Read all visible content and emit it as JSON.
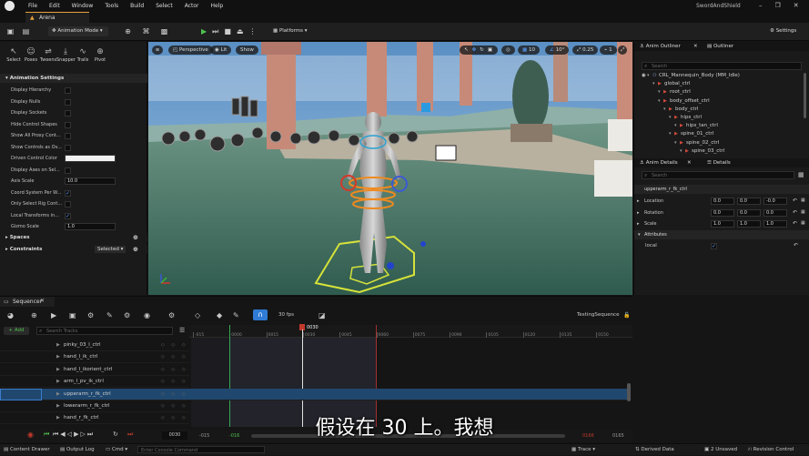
{
  "app": {
    "project_name": "SwordAndShield",
    "level_tab": "Arena"
  },
  "menu": [
    "File",
    "Edit",
    "Window",
    "Tools",
    "Build",
    "Select",
    "Actor",
    "Help"
  ],
  "toolbar": {
    "mode": "Animation Mode",
    "platforms": "Platforms",
    "settings": "Settings"
  },
  "left_panel": {
    "tools": [
      "Select",
      "Poses",
      "Tweens",
      "Snapper",
      "Trails",
      "Pivot"
    ],
    "animation_settings_title": "Animation Settings",
    "rows": [
      {
        "label": "Display Hierarchy",
        "kind": "check",
        "on": false
      },
      {
        "label": "Display Nulls",
        "kind": "check",
        "on": false
      },
      {
        "label": "Display Sockets",
        "kind": "check",
        "on": false
      },
      {
        "label": "Hide Control Shapes",
        "kind": "check",
        "on": false
      },
      {
        "label": "Show All Proxy Cont...",
        "kind": "check",
        "on": false
      },
      {
        "label": "Show Controls as Ov...",
        "kind": "check",
        "on": false
      },
      {
        "label": "Driven Control Color",
        "kind": "color"
      },
      {
        "label": "Display Axes on Sel...",
        "kind": "check",
        "on": false
      },
      {
        "label": "Axis Scale",
        "kind": "value",
        "value": "10.0"
      },
      {
        "label": "Coord System Per W...",
        "kind": "check",
        "on": true
      },
      {
        "label": "Only Select Rig Cont...",
        "kind": "check",
        "on": false
      },
      {
        "label": "Local Transforms in...",
        "kind": "check",
        "on": true
      },
      {
        "label": "Gizmo Scale",
        "kind": "value",
        "value": "1.0"
      }
    ],
    "spaces_title": "Spaces",
    "constraints_title": "Constraints",
    "constraints_value": "Selected"
  },
  "viewport": {
    "perspective": "Perspective",
    "lit": "Lit",
    "show": "Show",
    "grid": "10",
    "angle": "10°",
    "scale": "0.25",
    "cams": "1"
  },
  "outliner": {
    "tab1": "Anim Outliner",
    "tab2": "Outliner",
    "search_placeholder": "Search",
    "items": [
      {
        "label": "CRL_Mannequin_Body (MM_Idle)",
        "indent": 0
      },
      {
        "label": "global_ctrl",
        "indent": 1
      },
      {
        "label": "root_ctrl",
        "indent": 2
      },
      {
        "label": "body_offset_ctrl",
        "indent": 2
      },
      {
        "label": "body_ctrl",
        "indent": 3
      },
      {
        "label": "hips_ctrl",
        "indent": 4
      },
      {
        "label": "hips_tan_ctrl",
        "indent": 5
      },
      {
        "label": "spine_01_ctrl",
        "indent": 4
      },
      {
        "label": "spine_02_ctrl",
        "indent": 5
      },
      {
        "label": "spine_03_ctrl",
        "indent": 6
      }
    ]
  },
  "details": {
    "tab1": "Anim Details",
    "tab2": "Details",
    "search_placeholder": "Search",
    "control_name": "upperarm_r_fk_ctrl",
    "rows": [
      {
        "label": "Location",
        "values": [
          "0.0",
          "0.0",
          "-0.0"
        ]
      },
      {
        "label": "Rotation",
        "values": [
          "0.0",
          "0.0",
          "0.0"
        ]
      },
      {
        "label": "Scale",
        "values": [
          "1.0",
          "1.0",
          "1.0"
        ]
      }
    ],
    "attributes_title": "Attributes",
    "attribute_label": "local"
  },
  "sequencer": {
    "tab": "Sequencer",
    "fps": "30 fps",
    "sequence_name": "TestingSequence",
    "add_label": "+ Add",
    "search_placeholder": "Search Tracks",
    "current_frame": "0030",
    "ticks": [
      "-015",
      "0000",
      "0015",
      "0030",
      "0045",
      "0060",
      "0075",
      "0090",
      "0105",
      "0120",
      "0135",
      "0150"
    ],
    "tracks": [
      "pinky_03_l_ctrl",
      "hand_l_ik_ctrl",
      "hand_l_ikorient_ctrl",
      "arm_l_pv_ik_ctrl",
      "upperarm_r_fk_ctrl",
      "lowerarm_r_fk_ctrl",
      "hand_r_fk_ctrl"
    ],
    "selected_track": 4,
    "range_start": "-015",
    "range_in": "-016",
    "range_end": "0165",
    "range_out": "0166",
    "frame_field": "0030"
  },
  "statusbar": {
    "content_drawer": "Content Drawer",
    "output_log": "Output Log",
    "cmd": "Cmd",
    "console_placeholder": "Enter Console Command",
    "trace": "Trace",
    "derived_data": "Derived Data",
    "unsaved": "2 Unsaved",
    "revision": "Revision Control"
  },
  "subtitle": "假设在 30 上。我想",
  "colors": {
    "accent": "#2f7bd6",
    "selected_row": "#20486f",
    "playhead": "#c0392b",
    "range_green": "#3aa655"
  }
}
